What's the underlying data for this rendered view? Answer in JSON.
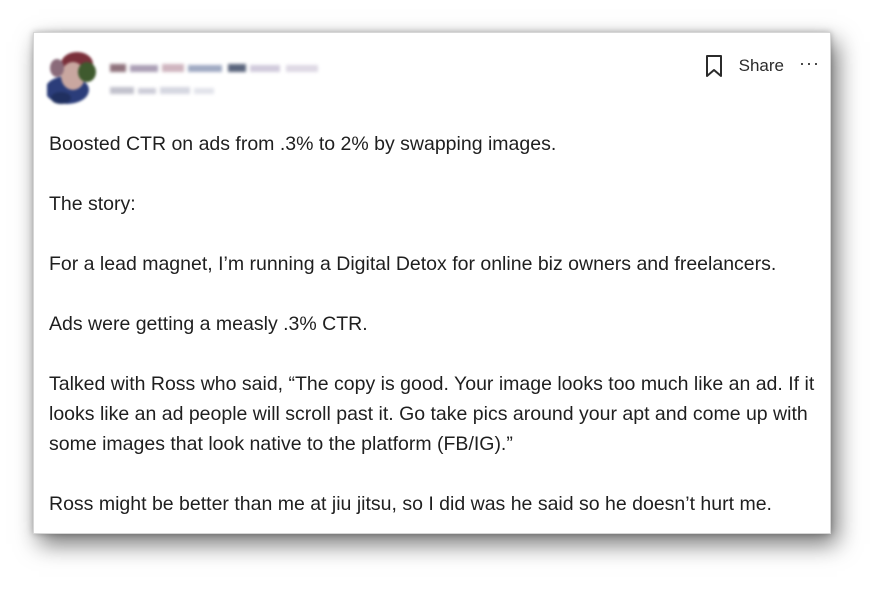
{
  "header": {
    "share_label": "Share",
    "more_label": "···"
  },
  "post": {
    "paragraphs": [
      "Boosted CTR on ads from .3% to 2% by swapping images.",
      "The story:",
      "For a lead magnet, I’m running a Digital Detox for online biz owners and freelancers.",
      "Ads were getting a measly .3% CTR.",
      "Talked with Ross who said, “The copy is good. Your image looks too much like an ad. If it looks like an ad people will scroll past it. Go take pics around your apt and come up with some images that look native to the platform (FB/IG).”",
      "Ross might be better than me at jiu jitsu, so I did was he said so he doesn’t hurt me."
    ]
  },
  "icons": {
    "bookmark": "bookmark-icon",
    "more": "more-icon"
  }
}
